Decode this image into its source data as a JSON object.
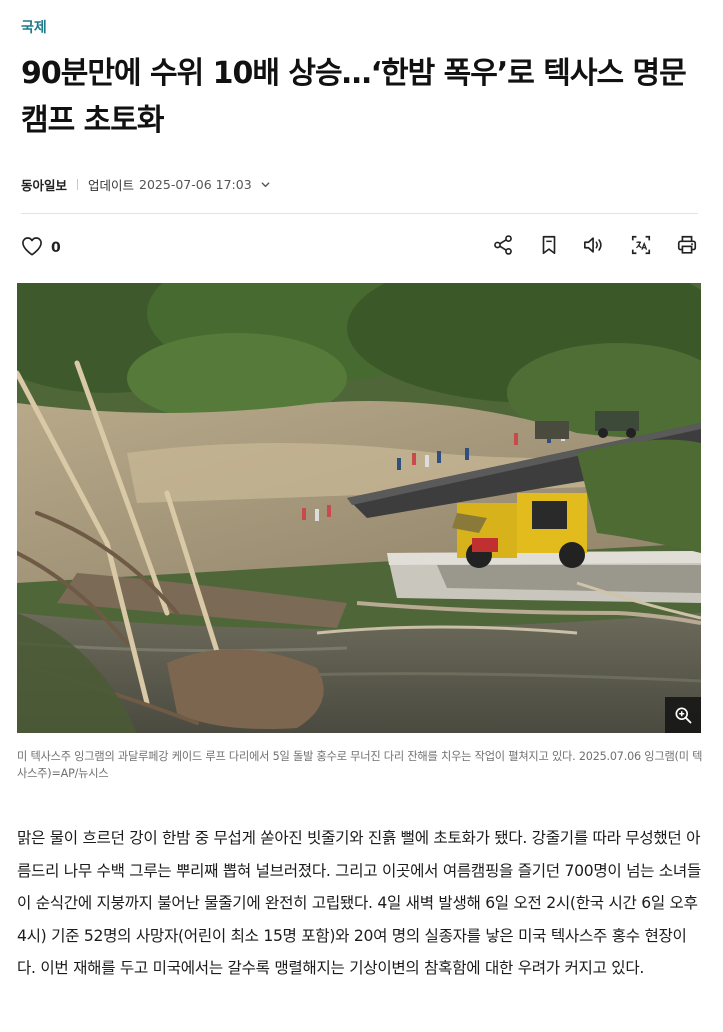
{
  "article": {
    "category": "국제",
    "headline": "90분만에 수위 10배 상승…‘한밤 폭우’로 텍사스 명문캠프 초토화",
    "source": "동아일보",
    "updated_label": "업데이트",
    "updated_time": "2025-07-06 17:03",
    "like_count": "0",
    "image_caption": "미 텍사스주 잉그램의 과달루페강 케이드 루프 다리에서 5일 돌발 홍수로 무너진 다리 잔해를 치우는 작업이 펼쳐지고 있다. 2025.07.06 잉그램(미 텍사스주)=AP/뉴시스",
    "body": "맑은 물이 흐르던 강이 한밤 중 무섭게 쏟아진 빗줄기와 진흙 뻘에 초토화가 됐다. 강줄기를 따라 무성했던 아름드리 나무 수백 그루는 뿌리째 뽑혀 널브러졌다. 그리고 이곳에서 여름캠핑을 즐기던 700명이 넘는 소녀들이 순식간에 지붕까지 불어난 물줄기에 완전히 고립됐다. 4일 새벽 발생해 6일 오전 2시(한국 시간 6일 오후 4시) 기준 52명의 사망자(어린이 최소 15명 포함)와 20여 명의 실종자를 낳은 미국 텍사스주 홍수 현장이다. 이번 재해를 두고 미국에서는 갈수록 맹렬해지는 기상이변의 참혹함에 대한 우려가 커지고 있다."
  },
  "icons": {
    "like": "heart-icon",
    "updated_toggle": "chevron-down-icon",
    "share": "share-icon",
    "bookmark": "bookmark-icon",
    "listen": "speaker-icon",
    "translate": "translate-icon",
    "print": "print-icon",
    "zoom": "zoom-in-icon"
  },
  "colors": {
    "category": "#1f7a8c",
    "text": "#111111",
    "caption": "#707070"
  }
}
